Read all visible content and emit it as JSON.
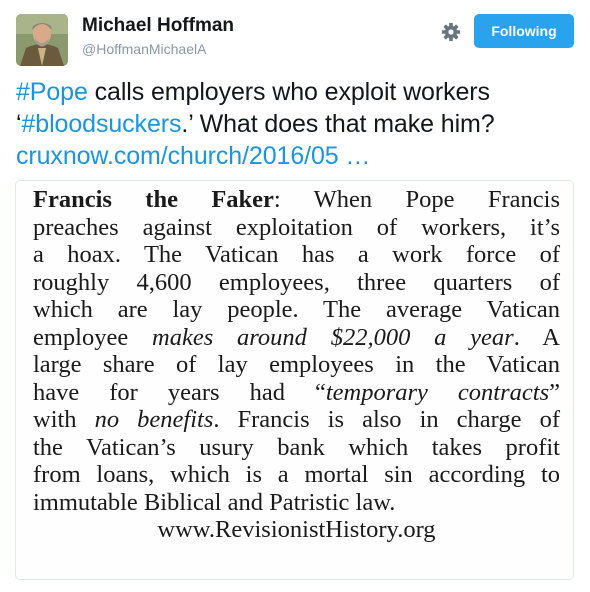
{
  "user": {
    "name": "Michael Hoffman",
    "handle": "@HoffmanMichaelA"
  },
  "follow_label": "Following",
  "icons": {
    "settings": "gear-icon",
    "avatar": "profile-photo"
  },
  "colors": {
    "link": "#1b95e0",
    "follow_button": "#2aa3ef",
    "handle": "#8899a6"
  },
  "tweet": {
    "hashtag_pope": "#Pope",
    "line1_rest": " calls employers who exploit workers",
    "quote_open": "‘",
    "hashtag_bloodsuckers": "#bloodsuckers",
    "line2_rest": ".’ What does that make him?",
    "link": "cruxnow.com/church/2016/05 …"
  },
  "article": {
    "title": "Francis the Faker",
    "l1_rest": ": When Pope Francis",
    "l2": "preaches against exploitation of workers, it’s",
    "l3": "a hoax. The Vatican has a work force of",
    "l4": "roughly 4,600 employees, three quarters of",
    "l5": "which are lay people. The average Vatican",
    "l6_a": "employee ",
    "l6_em": "makes around $22,000 a year",
    "l6_b": ". A",
    "l7": "large share of lay employees in the Vatican",
    "l8_a": "have for years had “",
    "l8_em": "temporary contracts",
    "l8_b": "”",
    "l9_a": "with ",
    "l9_em": "no benefits",
    "l9_b": ". Francis is also in charge of",
    "l10": "the Vatican’s usury bank which takes profit",
    "l11": "from loans, which is a mortal sin according to",
    "l12": "immutable Biblical and Patristic law.",
    "site": "www.RevisionistHistory.org"
  }
}
